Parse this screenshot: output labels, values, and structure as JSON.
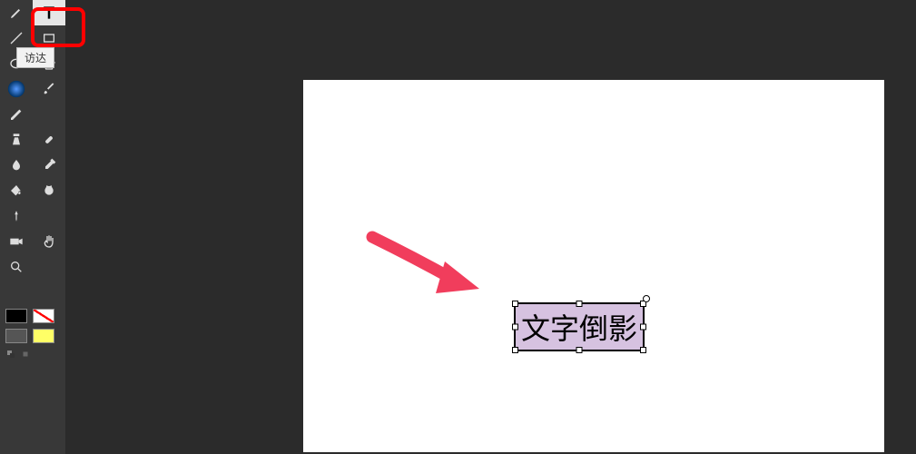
{
  "toolbar": {
    "tools": [
      {
        "name": "pen-tool"
      },
      {
        "name": "text-tool",
        "highlighted": true
      },
      {
        "name": "line-tool"
      },
      {
        "name": "ellipse-tool"
      },
      {
        "name": "polygon-tool"
      },
      {
        "name": "gradient-tool"
      },
      {
        "name": "paintbrush-tool"
      },
      {
        "name": "pencil-tool"
      },
      {
        "name": "clone-tool"
      },
      {
        "name": "healing-tool"
      },
      {
        "name": "eyedropper-tool"
      },
      {
        "name": "blend-tool"
      },
      {
        "name": "eraser-tool"
      },
      {
        "name": "smudge-tool"
      },
      {
        "name": "pin-tool"
      },
      {
        "name": "camera-tool"
      },
      {
        "name": "hand-tool"
      },
      {
        "name": "zoom-tool"
      }
    ],
    "tooltip_text": "访达"
  },
  "colors": {
    "stroke_fg": "#000000",
    "stroke_bg": "none",
    "fill_primary": "#555555",
    "fill_secondary": "#ffff66"
  },
  "canvas": {
    "text_content": "文字倒影",
    "selection_color": "#d6c2e0"
  },
  "annotations": {
    "highlight_color": "#ff0000",
    "arrow_color": "#f13d5c"
  }
}
